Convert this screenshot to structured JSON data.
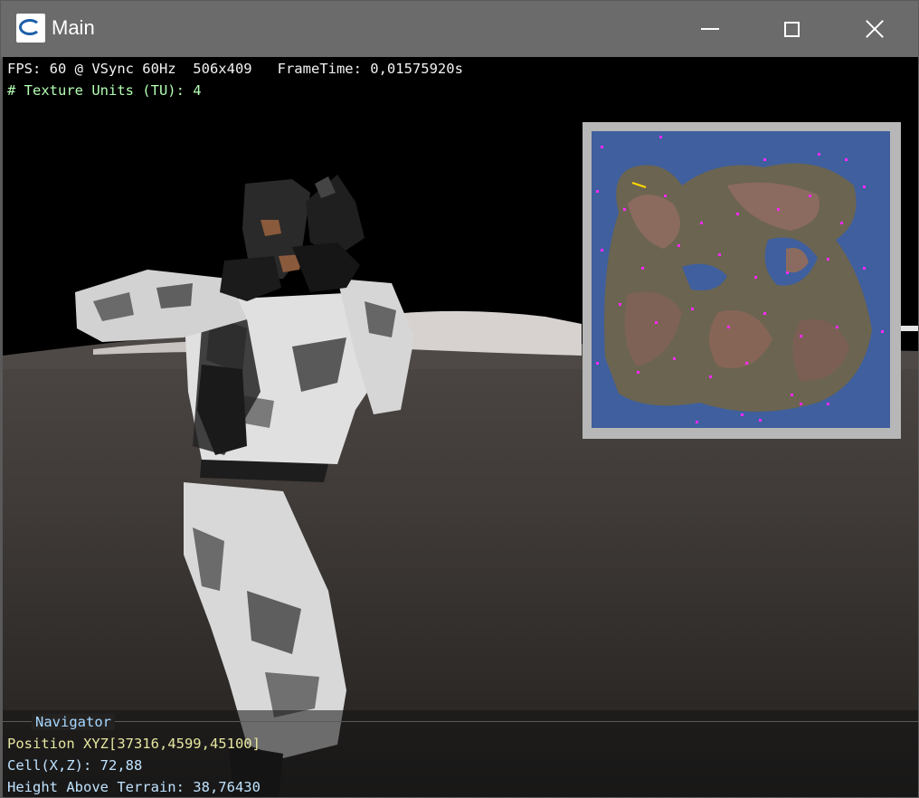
{
  "window": {
    "title": "Main",
    "icon": "app-c-icon"
  },
  "controls": {
    "minimize": "minimize-icon",
    "maximize": "maximize-icon",
    "close": "close-icon"
  },
  "hud": {
    "fps_line": "FPS: 60 @ VSync 60Hz  506x409   FrameTime: 0,01575920s",
    "tu_line": "# Texture Units (TU): 4"
  },
  "navigator": {
    "title": "Navigator",
    "position": "Position XYZ[37316,4599,45100]",
    "cell": "Cell(X,Z): 72,88",
    "height": "Height Above Terrain: 38,76430"
  },
  "colors": {
    "minimap_marker": "#ff28ff",
    "player_marker": "#ffd800",
    "water": "#3f5f9e",
    "frame": "#b7b7b7"
  }
}
